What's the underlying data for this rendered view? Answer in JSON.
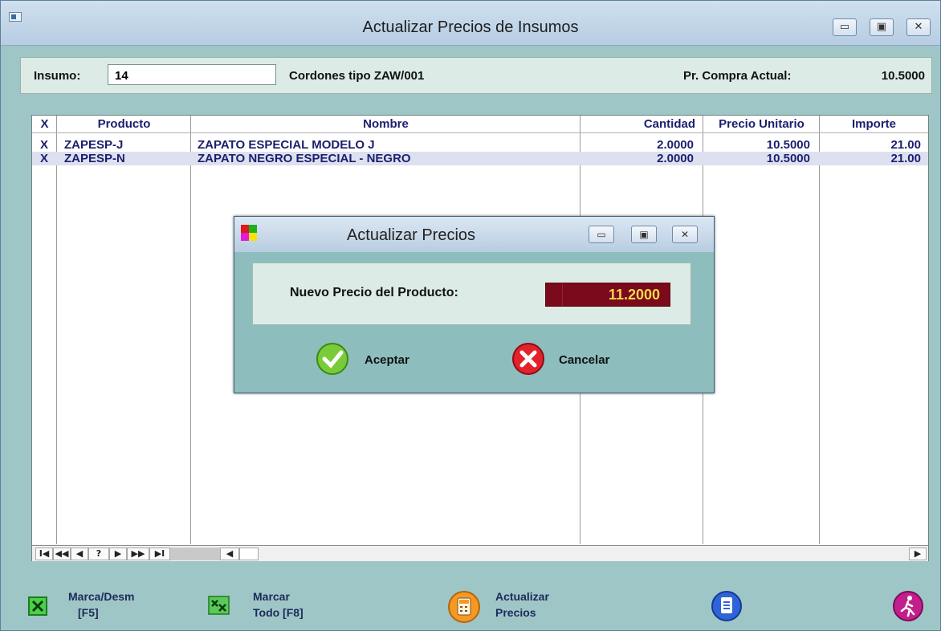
{
  "window": {
    "title": "Actualizar Precios de Insumos",
    "controls": {
      "minimize": "▭",
      "maximize": "▣",
      "close": "✕"
    }
  },
  "insumo": {
    "label": "Insumo:",
    "value": "14",
    "description": "Cordones tipo ZAW/001",
    "price_label": "Pr. Compra Actual:",
    "price_value": "10.5000"
  },
  "table": {
    "headers": [
      "X",
      "Producto",
      "Nombre",
      "Cantidad",
      "Precio Unitario",
      "Importe"
    ],
    "rows": [
      {
        "x": "X",
        "producto": "ZAPESP-J",
        "nombre": "ZAPATO ESPECIAL MODELO J",
        "cantidad": "2.0000",
        "precio": "10.5000",
        "importe": "21.00"
      },
      {
        "x": "X",
        "producto": "ZAPESP-N",
        "nombre": "ZAPATO NEGRO ESPECIAL - NEGRO",
        "cantidad": "2.0000",
        "precio": "10.5000",
        "importe": "21.00"
      }
    ],
    "nav": {
      "first": "I◀",
      "prev_page": "◀◀",
      "prev": "◀",
      "find": "?",
      "next": "▶",
      "next_page": "▶▶",
      "last": "▶I",
      "scroll_left": "◀",
      "scroll_right": "▶"
    }
  },
  "toolbar": {
    "marca_desm": {
      "line1": "Marca/Desm",
      "line2": "[F5]"
    },
    "marcar_todo": {
      "line1": "Marcar",
      "line2": "Todo [F8]"
    },
    "actualizar": {
      "line1": "Actualizar",
      "line2": "Precios"
    }
  },
  "dialog": {
    "title": "Actualizar Precios",
    "label": "Nuevo Precio del Producto:",
    "value": "11.2000",
    "accept": "Aceptar",
    "cancel": "Cancelar"
  },
  "colors": {
    "accent_row": "#dde0ef",
    "price_box": "#7a0a1c",
    "price_text": "#f5d84a"
  }
}
